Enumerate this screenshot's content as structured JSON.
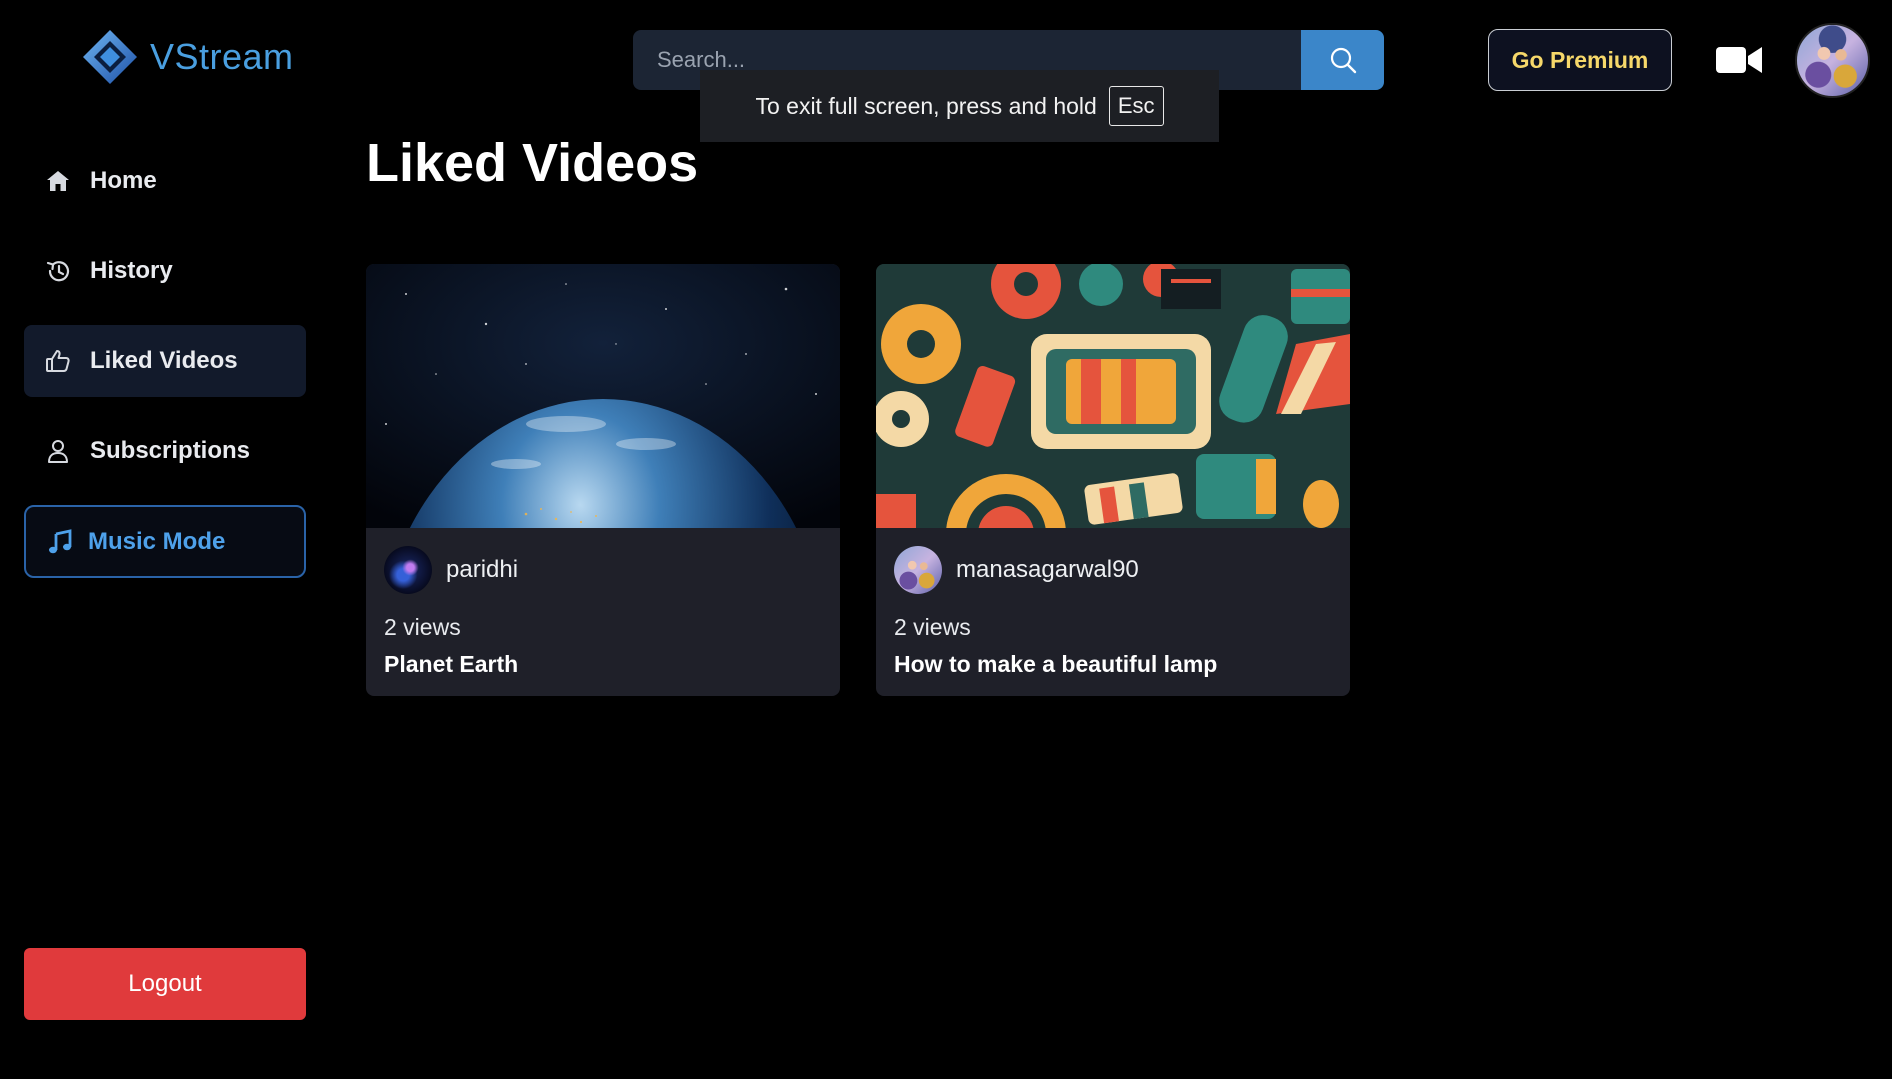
{
  "app": {
    "name": "VStream",
    "accent": "#4a9fe0"
  },
  "header": {
    "search_placeholder": "Search...",
    "premium_label": "Go Premium",
    "fullscreen_hint": "To exit full screen, press and hold",
    "fullscreen_key": "Esc"
  },
  "sidebar": {
    "items": [
      {
        "label": "Home",
        "icon": "home-icon"
      },
      {
        "label": "History",
        "icon": "history-icon"
      },
      {
        "label": "Liked Videos",
        "icon": "thumbs-up-icon",
        "active": true
      },
      {
        "label": "Subscriptions",
        "icon": "user-icon"
      }
    ],
    "music_mode_label": "Music Mode",
    "logout_label": "Logout"
  },
  "main": {
    "title": "Liked Videos",
    "videos": [
      {
        "channel": "paridhi",
        "views": "2 views",
        "title": "Planet Earth"
      },
      {
        "channel": "manasagarwal90",
        "views": "2 views",
        "title": "How to make a beautiful lamp"
      }
    ]
  },
  "colors": {
    "background": "#000000",
    "card": "#1f2029",
    "search_button": "#3b86c9",
    "logout": "#e03a3c",
    "premium_text": "#f6d86a",
    "music_mode": "#4ea1ea"
  }
}
